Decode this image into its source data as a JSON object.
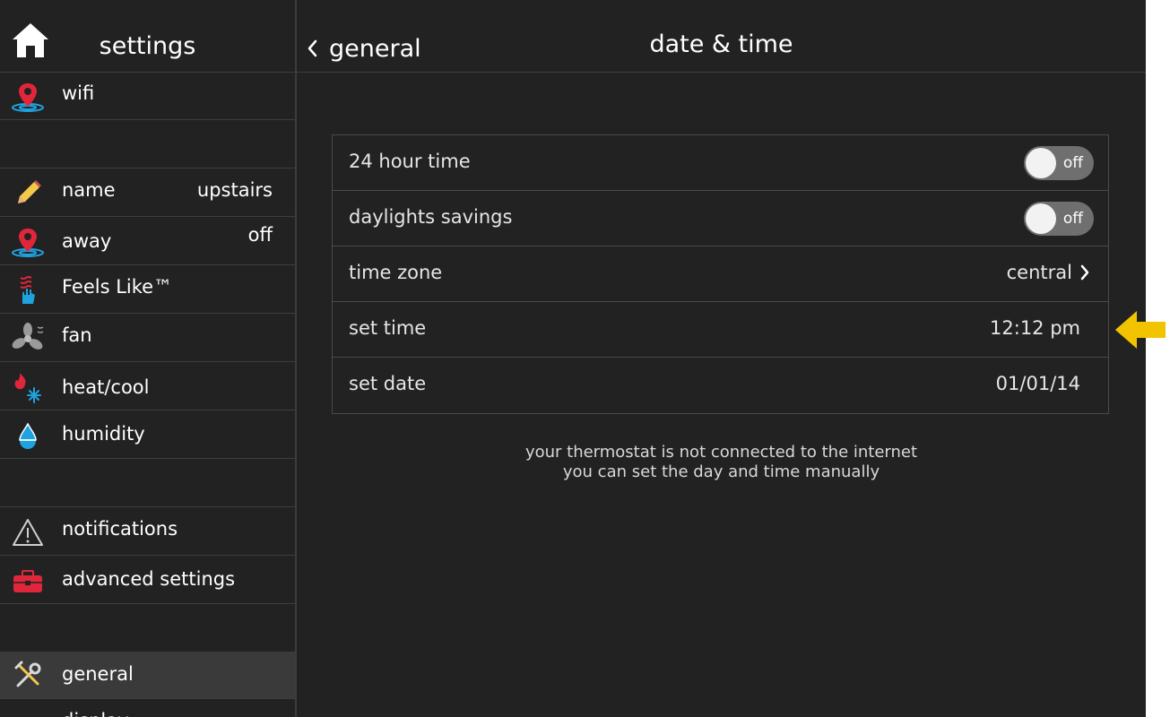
{
  "sidebar": {
    "title": "settings",
    "items": [
      {
        "label": "wifi",
        "value": "",
        "icon": "wifi-pin-icon"
      },
      {
        "label": "name",
        "value": "upstairs",
        "icon": "pencil-icon"
      },
      {
        "label": "away",
        "value": "off",
        "icon": "away-pin-icon"
      },
      {
        "label": "Feels Like™",
        "value": "",
        "icon": "feels-like-icon"
      },
      {
        "label": "fan",
        "value": "",
        "icon": "fan-icon"
      },
      {
        "label": "heat/cool",
        "value": "",
        "icon": "heat-cool-icon"
      },
      {
        "label": "humidity",
        "value": "",
        "icon": "humidity-drop-icon"
      },
      {
        "label": "notifications",
        "value": "",
        "icon": "warning-triangle-icon"
      },
      {
        "label": "advanced settings",
        "value": "",
        "icon": "toolbox-icon"
      },
      {
        "label": "general",
        "value": "",
        "icon": "tools-icon"
      },
      {
        "label": "display",
        "value": "",
        "icon": "display-icon"
      }
    ]
  },
  "header": {
    "back_label": "general",
    "title": "date & time"
  },
  "rows": [
    {
      "label": "24 hour time",
      "toggle": "off"
    },
    {
      "label": "daylights savings",
      "toggle": "off"
    },
    {
      "label": "time zone",
      "value": "central"
    },
    {
      "label": "set time",
      "value": "12:12 pm"
    },
    {
      "label": "set date",
      "value": "01/01/14"
    }
  ],
  "info": {
    "line1": "your thermostat is not connected to the internet",
    "line2": "you can set the day and time manually"
  },
  "colors": {
    "background": "#222222",
    "highlight_arrow": "#f2c400",
    "icon_red": "#e0263a",
    "icon_blue": "#1fa3e0"
  }
}
